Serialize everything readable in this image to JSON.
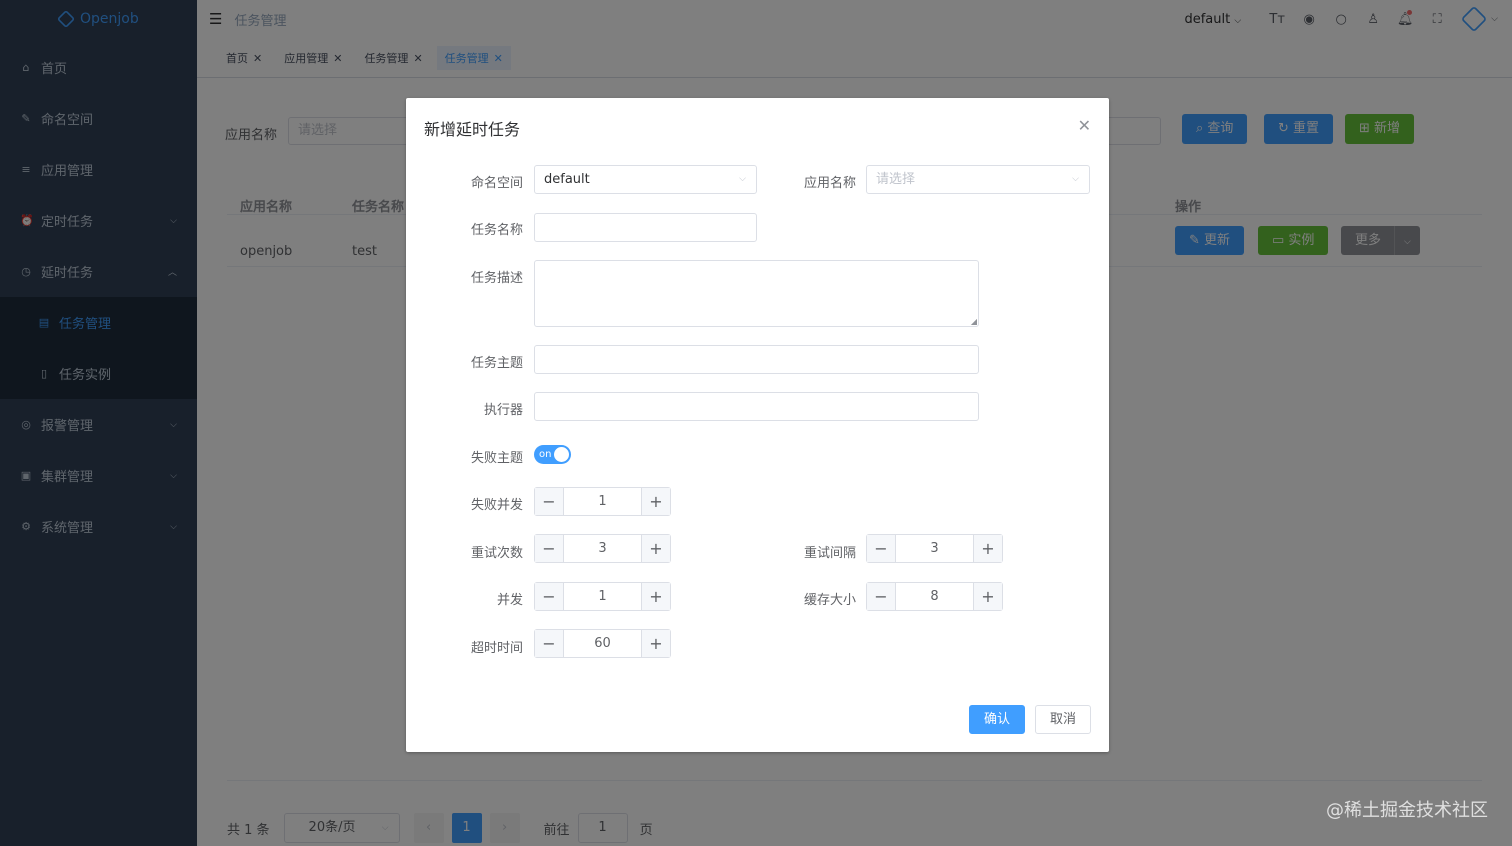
{
  "sidebar": {
    "logo_text": "Openjob",
    "items": [
      {
        "label": "首页",
        "icon": "home-icon"
      },
      {
        "label": "命名空间",
        "icon": "edit-icon"
      },
      {
        "label": "应用管理",
        "icon": "sliders-icon"
      },
      {
        "label": "定时任务",
        "icon": "alarm-clock-icon"
      },
      {
        "label": "延时任务",
        "icon": "clock-icon"
      },
      {
        "label": "任务管理",
        "icon": "list-icon"
      },
      {
        "label": "任务实例",
        "icon": "document-icon"
      },
      {
        "label": "报警管理",
        "icon": "alert-icon"
      },
      {
        "label": "集群管理",
        "icon": "cluster-icon"
      },
      {
        "label": "系统管理",
        "icon": "gear-icon"
      }
    ]
  },
  "topbar": {
    "breadcrumb": "任务管理",
    "namespace": "default"
  },
  "tags": [
    {
      "label": "首页"
    },
    {
      "label": "应用管理"
    },
    {
      "label": "任务管理"
    },
    {
      "label": "任务管理"
    }
  ],
  "filter": {
    "app_label": "应用名称",
    "app_placeholder": "请选择",
    "query": "查询",
    "reset": "重置",
    "add": "新增"
  },
  "table": {
    "headers": [
      "应用名称",
      "任务名称",
      "操作"
    ],
    "rows": [
      {
        "app": "openjob",
        "task": "test",
        "update": "更新",
        "instance": "实例",
        "more": "更多"
      }
    ]
  },
  "pager": {
    "total": "共 1 条",
    "size": "20条/页",
    "current": "1",
    "goto": "前往",
    "goto_value": "1",
    "page_unit": "页"
  },
  "dialog": {
    "title": "新增延时任务",
    "namespace_label": "命名空间",
    "namespace_value": "default",
    "app_label": "应用名称",
    "app_placeholder": "请选择",
    "task_name_label": "任务名称",
    "task_desc_label": "任务描述",
    "topic_label": "任务主题",
    "executor_label": "执行器",
    "fail_topic_label": "失败主题",
    "fail_topic_switch": "on",
    "fail_concurrency_label": "失败并发",
    "fail_concurrency_value": "1",
    "retry_times_label": "重试次数",
    "retry_times_value": "3",
    "retry_interval_label": "重试间隔",
    "retry_interval_value": "3",
    "concurrency_label": "并发",
    "concurrency_value": "1",
    "cache_size_label": "缓存大小",
    "cache_size_value": "8",
    "timeout_label": "超时时间",
    "timeout_value": "60",
    "confirm": "确认",
    "cancel": "取消"
  },
  "watermark": "@稀土掘金技术社区",
  "colors": {
    "primary": "#409eff",
    "success": "#67c23a",
    "sidebar": "#304156"
  }
}
